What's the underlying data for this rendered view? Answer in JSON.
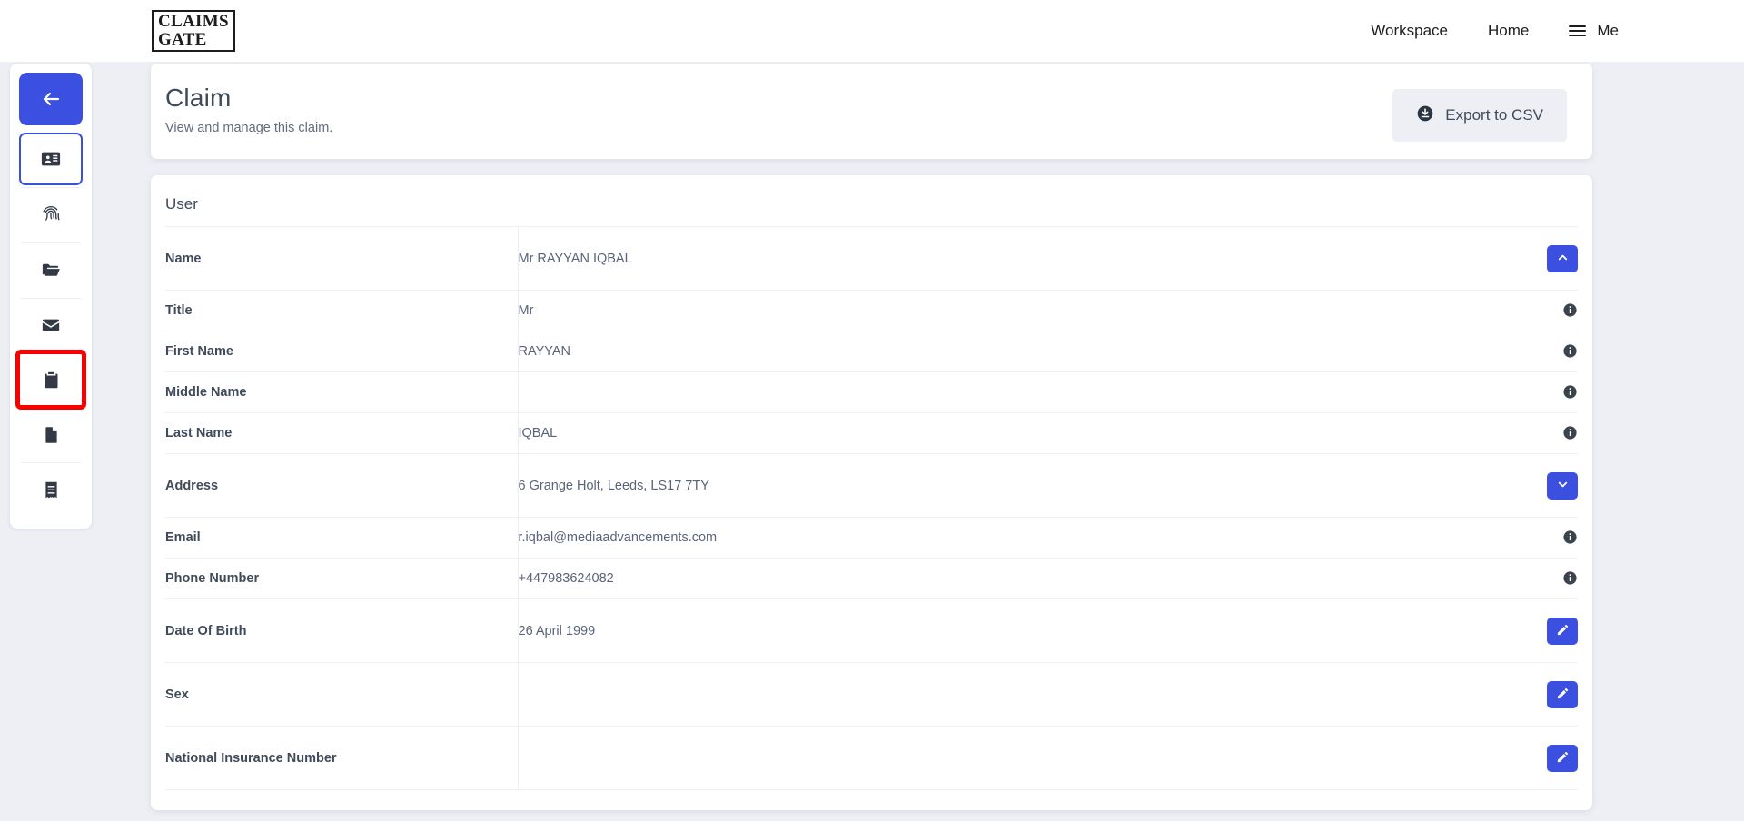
{
  "topbar": {
    "logo_line1": "CLAIMS",
    "logo_line2": "GATE",
    "nav": [
      {
        "label": "Workspace",
        "name": "nav-workspace"
      },
      {
        "label": "Home",
        "name": "nav-home"
      }
    ],
    "me_label": "Me"
  },
  "sidebar": {
    "items": [
      {
        "icon": "arrow-left-icon",
        "state": "primary"
      },
      {
        "icon": "id-card-icon",
        "state": "selected"
      },
      {
        "icon": "fingerprint-icon",
        "state": "normal"
      },
      {
        "icon": "folder-icon",
        "state": "normal"
      },
      {
        "icon": "envelope-icon",
        "state": "normal"
      },
      {
        "icon": "clipboard-icon",
        "state": "flagged"
      },
      {
        "icon": "file-icon",
        "state": "normal"
      },
      {
        "icon": "receipt-icon",
        "state": "normal"
      }
    ],
    "highlight_color": "#fc0000",
    "accent_color": "#3b4fe0"
  },
  "header": {
    "title": "Claim",
    "subtitle": "View and manage this claim.",
    "export_label": "Export to CSV",
    "export_icon": "download-circle-icon"
  },
  "user_section": {
    "title": "User",
    "rows": [
      {
        "label": "Name",
        "value": "Mr RAYYAN IQBAL",
        "action": "chevron-up",
        "height": "tall"
      },
      {
        "label": "Title",
        "value": "Mr",
        "action": "info",
        "height": "short"
      },
      {
        "label": "First Name",
        "value": "RAYYAN",
        "action": "info",
        "height": "short"
      },
      {
        "label": "Middle Name",
        "value": "",
        "action": "info",
        "height": "short"
      },
      {
        "label": "Last Name",
        "value": "IQBAL",
        "action": "info",
        "height": "short"
      },
      {
        "label": "Address",
        "value": "6 Grange Holt, Leeds, LS17 7TY",
        "action": "chevron-down",
        "height": "tall"
      },
      {
        "label": "Email",
        "value": "r.iqbal@mediaadvancements.com",
        "action": "info",
        "height": "short"
      },
      {
        "label": "Phone Number",
        "value": "+447983624082",
        "action": "info",
        "height": "short"
      },
      {
        "label": "Date Of Birth",
        "value": "26 April 1999",
        "action": "edit",
        "height": "tall"
      },
      {
        "label": "Sex",
        "value": "",
        "action": "edit",
        "height": "tall"
      },
      {
        "label": "National Insurance Number",
        "value": "",
        "action": "edit",
        "height": "tall"
      }
    ]
  },
  "colors": {
    "accent": "#3b4fe0",
    "page_background": "#edeff4",
    "card": "#ffffff",
    "text_primary": "#3f4a5a",
    "text_secondary": "#59637a",
    "flag": "#fc0000"
  }
}
